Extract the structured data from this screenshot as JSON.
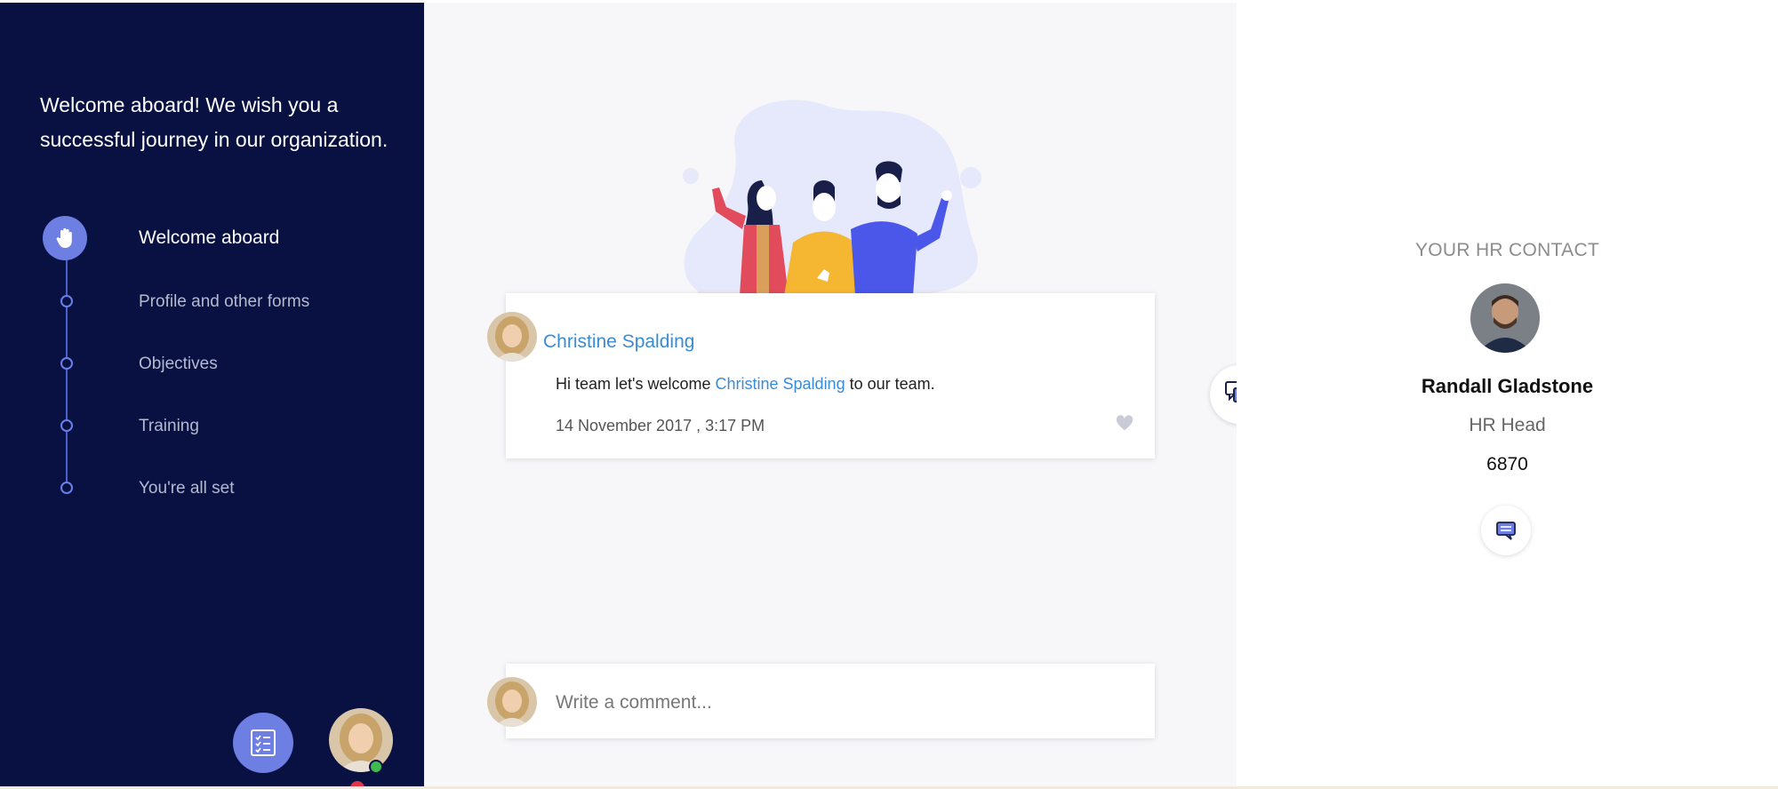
{
  "sidebar": {
    "welcome_message": "Welcome aboard! We wish you a successful journey in our organization.",
    "steps": [
      {
        "label": "Welcome aboard",
        "active": true
      },
      {
        "label": "Profile and other forms",
        "active": false
      },
      {
        "label": "Objectives",
        "active": false
      },
      {
        "label": "Training",
        "active": false
      },
      {
        "label": "You're all set",
        "active": false
      }
    ],
    "icons": {
      "active_step": "hand-wave-icon",
      "bottom_button": "checklist-icon",
      "user_avatar": "user-avatar"
    }
  },
  "post": {
    "author": "Christine Spalding",
    "text_before": "Hi team let's welcome ",
    "mention": "Christine Spalding",
    "text_after": " to our team.",
    "timestamp": "14 November 2017 , 3:17 PM"
  },
  "comment": {
    "placeholder": "Write a comment..."
  },
  "hr_contact": {
    "title": "YOUR HR CONTACT",
    "name": "Randall Gladstone",
    "role": "HR Head",
    "extension": "6870"
  },
  "colors": {
    "sidebar_bg": "#081142",
    "accent": "#6d7fe3",
    "link": "#3a8bd6",
    "main_bg": "#f7f7fa"
  }
}
